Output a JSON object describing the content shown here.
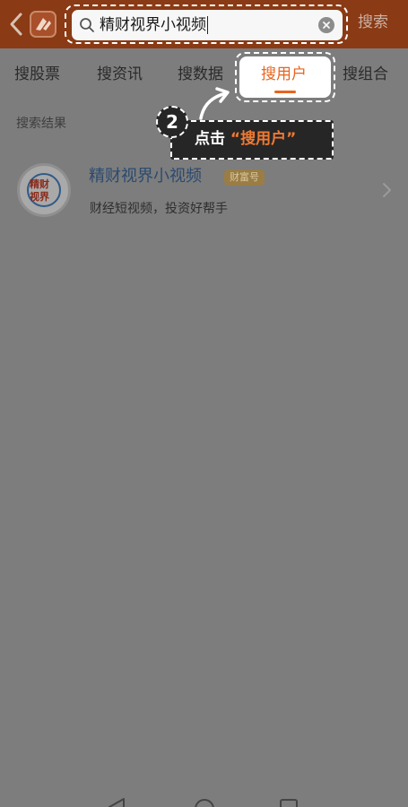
{
  "header": {
    "search_value": "精财视界小视频",
    "search_action_label": "搜索"
  },
  "tabs": [
    {
      "label": "搜股票"
    },
    {
      "label": "搜资讯"
    },
    {
      "label": "搜数据"
    },
    {
      "label": "搜用户",
      "active": true
    },
    {
      "label": "搜组合"
    }
  ],
  "tutorial": {
    "step_number": "2",
    "tooltip_prefix": "点击",
    "tooltip_highlight": "“搜用户”"
  },
  "results": {
    "section_label": "搜索结果",
    "items": [
      {
        "avatar_text_line1": "精财",
        "avatar_text_line2": "视界",
        "name": "精财视界小视频",
        "badge": "财富号",
        "description": "财经短视频，投资好帮手"
      }
    ]
  },
  "colors": {
    "header_bg": "#8a3a14",
    "accent": "#e8641e",
    "overlay": "#7d7d7d"
  },
  "icons": {
    "back": "back-arrow-icon",
    "logo": "app-logo-icon",
    "search": "search-icon",
    "clear": "clear-icon",
    "chevron": "chevron-right-icon",
    "nav": [
      "nav-back-icon",
      "nav-home-icon",
      "nav-recent-icon"
    ]
  }
}
